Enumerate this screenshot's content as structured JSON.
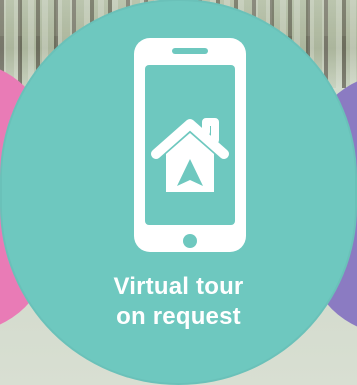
{
  "caption": {
    "line1": "Virtual tour",
    "line2": "on request"
  },
  "icons": {
    "phone": "phone-icon",
    "home": "home-icon",
    "navigation": "navigation-arrow-icon"
  },
  "colors": {
    "teal": "#6EC8BF",
    "pink": "#E97BB6",
    "purple": "#8B7BC2",
    "white": "#FFFFFF"
  }
}
